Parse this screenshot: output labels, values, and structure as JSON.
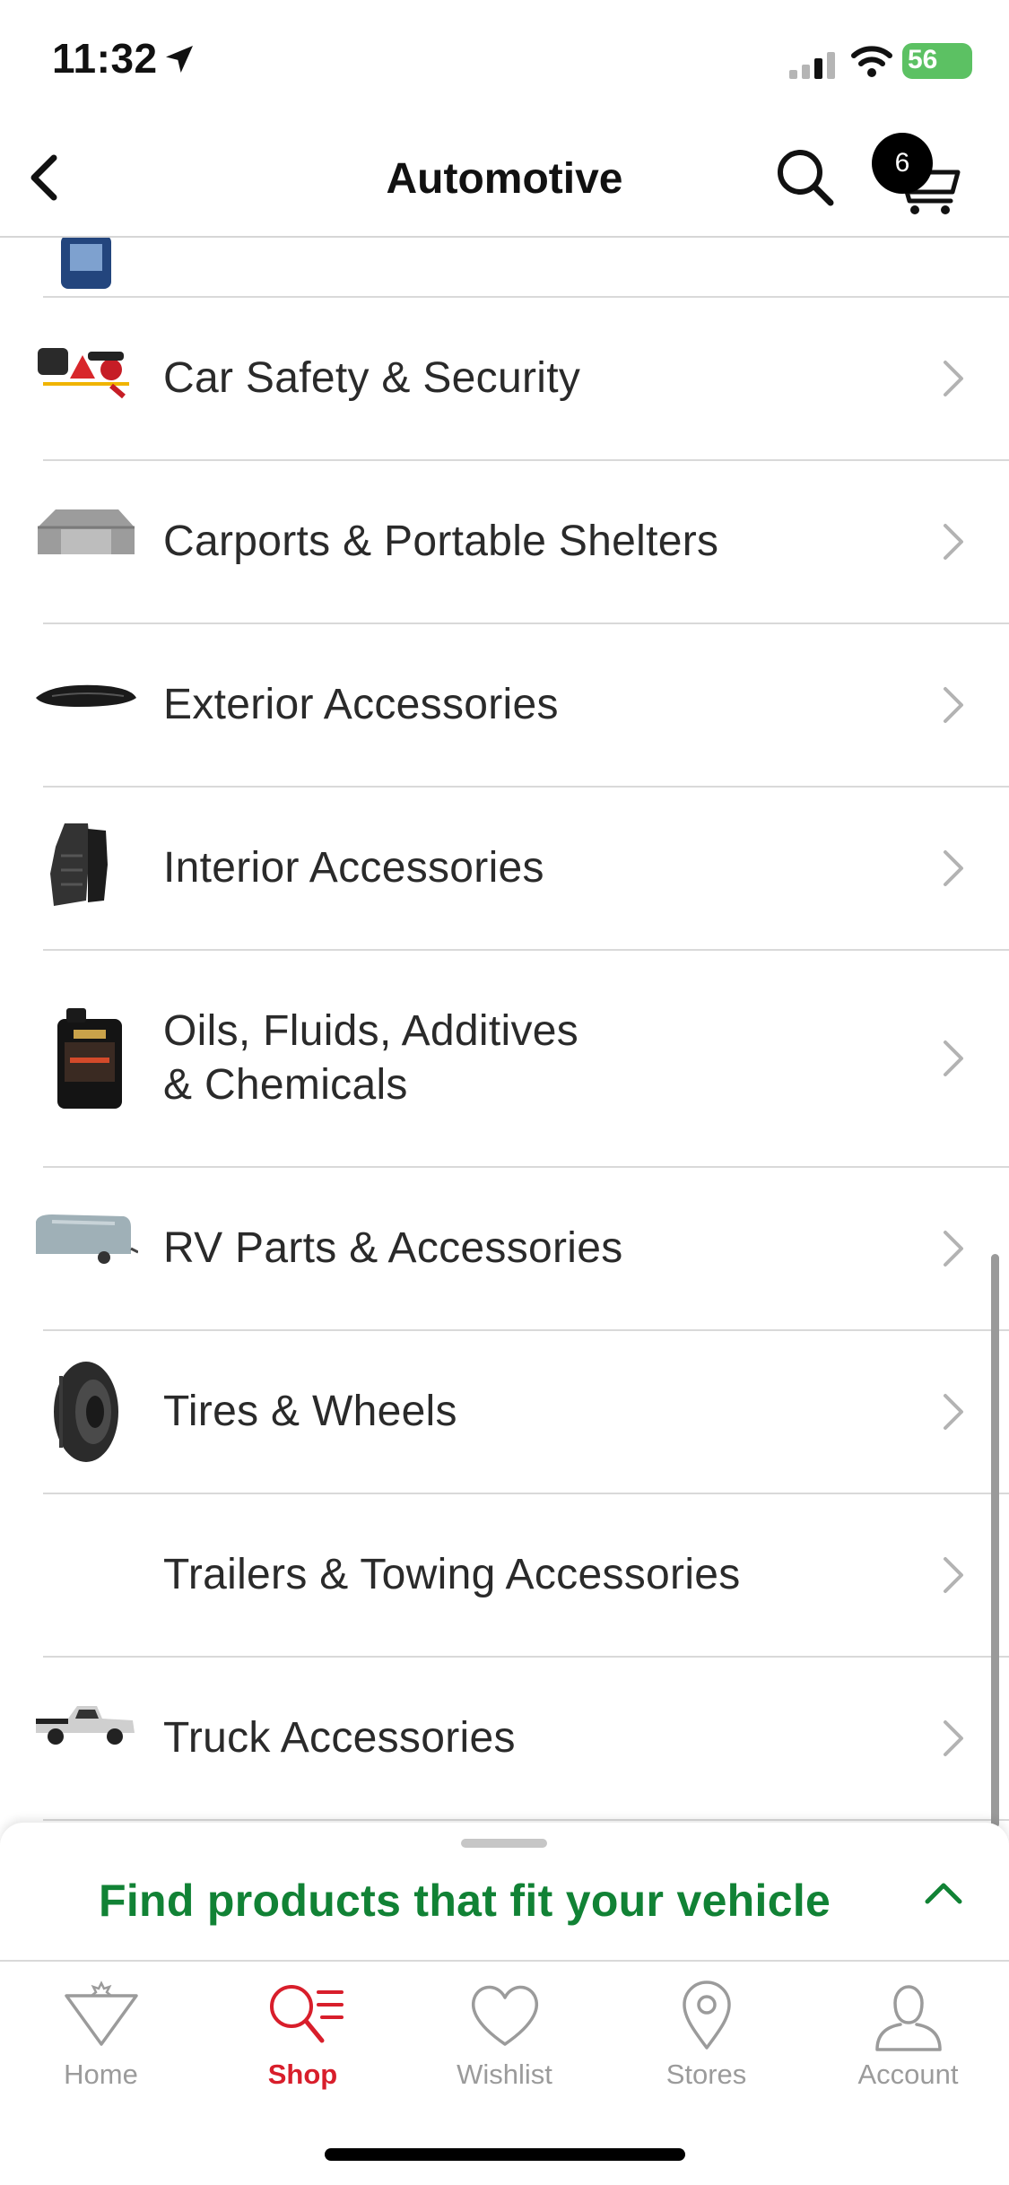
{
  "status_bar": {
    "time": "11:32",
    "battery": "56"
  },
  "header": {
    "title": "Automotive",
    "cart_count": "6"
  },
  "categories": [
    {
      "label": "",
      "icon": "fluid-bottle-thumbnail"
    },
    {
      "label": "Car Safety & Security",
      "icon": "safety-kit-thumbnail"
    },
    {
      "label": "Carports & Portable Shelters",
      "icon": "carport-thumbnail"
    },
    {
      "label": "Exterior Accessories",
      "icon": "roof-box-thumbnail"
    },
    {
      "label": "Interior Accessories",
      "icon": "floor-mat-thumbnail"
    },
    {
      "label": "Oils, Fluids, Additives",
      "label_line2": "& Chemicals",
      "icon": "oil-jug-thumbnail"
    },
    {
      "label": "RV Parts & Accessories",
      "icon": "rv-cover-thumbnail"
    },
    {
      "label": "Tires & Wheels",
      "icon": "tire-thumbnail"
    },
    {
      "label": "Trailers & Towing Accessories",
      "icon": ""
    },
    {
      "label": "Truck Accessories",
      "icon": "pickup-truck-thumbnail"
    }
  ],
  "vehicle_panel": {
    "text": "Find products that fit your vehicle"
  },
  "tabs": [
    {
      "label": "Home",
      "icon": "home-icon"
    },
    {
      "label": "Shop",
      "icon": "shop-search-icon",
      "active": true
    },
    {
      "label": "Wishlist",
      "icon": "heart-icon"
    },
    {
      "label": "Stores",
      "icon": "location-pin-icon"
    },
    {
      "label": "Account",
      "icon": "person-icon"
    }
  ],
  "colors": {
    "accent_red": "#d81e2b",
    "vehicle_green": "#118235",
    "battery_green": "#5cc163"
  }
}
